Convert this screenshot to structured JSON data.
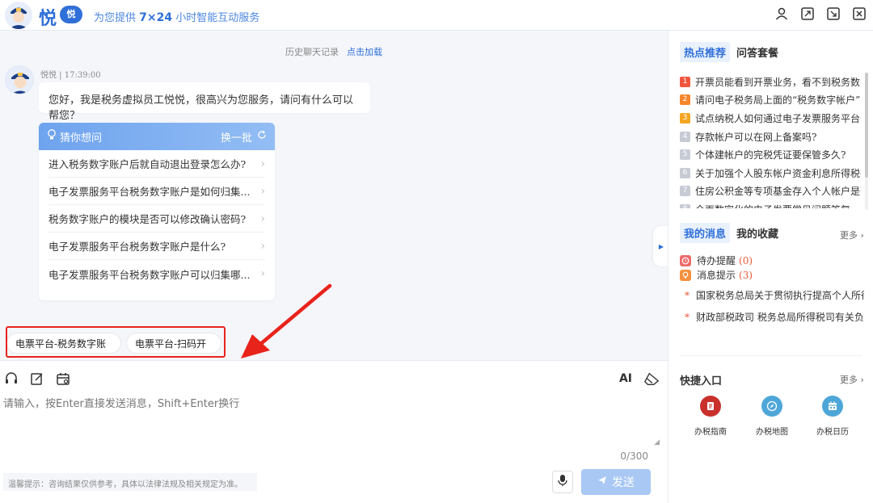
{
  "header": {
    "brand": "悦",
    "brand_badge": "悦",
    "tagline_prefix": "为您提供 ",
    "tagline_highlight": "7×24",
    "tagline_suffix": " 小时智能互动服务",
    "icons": [
      "user-icon",
      "expand-icon",
      "minimize-icon",
      "close-icon"
    ]
  },
  "chat": {
    "history_label": "历史聊天记录",
    "history_link": "点击加载",
    "bot_meta": "悦悦 | 17:39:00",
    "greeting": "您好，我是税务虚拟员工悦悦，很高兴为您服务，请问有什么可以帮您？",
    "suggest_title": "猜你想问",
    "suggest_refresh": "换一批",
    "suggestions": [
      "进入税务数字账户后就自动退出登录怎么办?",
      "电子发票服务平台税务数字账户是如何归集...",
      "税务数字账户的模块是否可以修改确认密码?",
      "电子发票服务平台税务数字账户是什么?",
      "电子发票服务平台税务数字账户可以归集哪..."
    ],
    "quick_chips": [
      "电票平台-税务数字账户",
      "电票平台-扫码开票"
    ]
  },
  "input": {
    "placeholder": "请输入，按Enter直接发送消息，Shift+Enter换行",
    "counter": "0/300",
    "ai_label": "AI",
    "disclaimer": "温馨提示：咨询结果仅供参考，具体以法律法规及相关规定为准。",
    "send_label": "发送"
  },
  "right": {
    "hot_tab": "热点推荐",
    "qa_tab": "问答套餐",
    "hot_items": [
      {
        "rank": "1",
        "color": "#f0563e",
        "text": "开票员能看到开票业务，看不到税务数字账户"
      },
      {
        "rank": "2",
        "color": "#f5862a",
        "text": "请问电子税务局上面的“税务数字帐户”是什么"
      },
      {
        "rank": "3",
        "color": "#f5a623",
        "text": "试点纳税人如何通过电子发票服务平台开具发票"
      },
      {
        "rank": "4",
        "color": "#c7cbd4",
        "text": "存款帐户可以在网上备案吗?"
      },
      {
        "rank": "5",
        "color": "#c7cbd4",
        "text": "个体建帐户的完税凭证要保管多久?"
      },
      {
        "rank": "6",
        "color": "#c7cbd4",
        "text": "关于加强个人股东帐户资金利息所得税征收管理"
      },
      {
        "rank": "7",
        "color": "#c7cbd4",
        "text": "住房公积金等专项基金存入个人帐户是否缴税"
      },
      {
        "rank": "8",
        "color": "#c7cbd4",
        "text": "全面数字化的电子发票常见问题答复"
      }
    ],
    "msg_tab": "我的消息",
    "fav_tab": "我的收藏",
    "more": "更多",
    "todo_label": "待办提醒",
    "todo_count": "(0)",
    "notice_label": "消息提示",
    "notice_count": "(3)",
    "news": [
      "国家税务总局关于贯彻执行提高个人所得税有关费用扣除标准",
      "财政部税政司 税务总局所得税司有关负责人就个人所得税"
    ],
    "quick_entry_title": "快捷入口",
    "quick_more": "更多",
    "entries": [
      {
        "label": "办税指南",
        "color": "#c9302c",
        "icon": "guide-icon"
      },
      {
        "label": "办税地图",
        "color": "#4ea6d8",
        "icon": "compass-icon"
      },
      {
        "label": "办税日历",
        "color": "#4ea6d8",
        "icon": "calendar-icon"
      }
    ]
  }
}
